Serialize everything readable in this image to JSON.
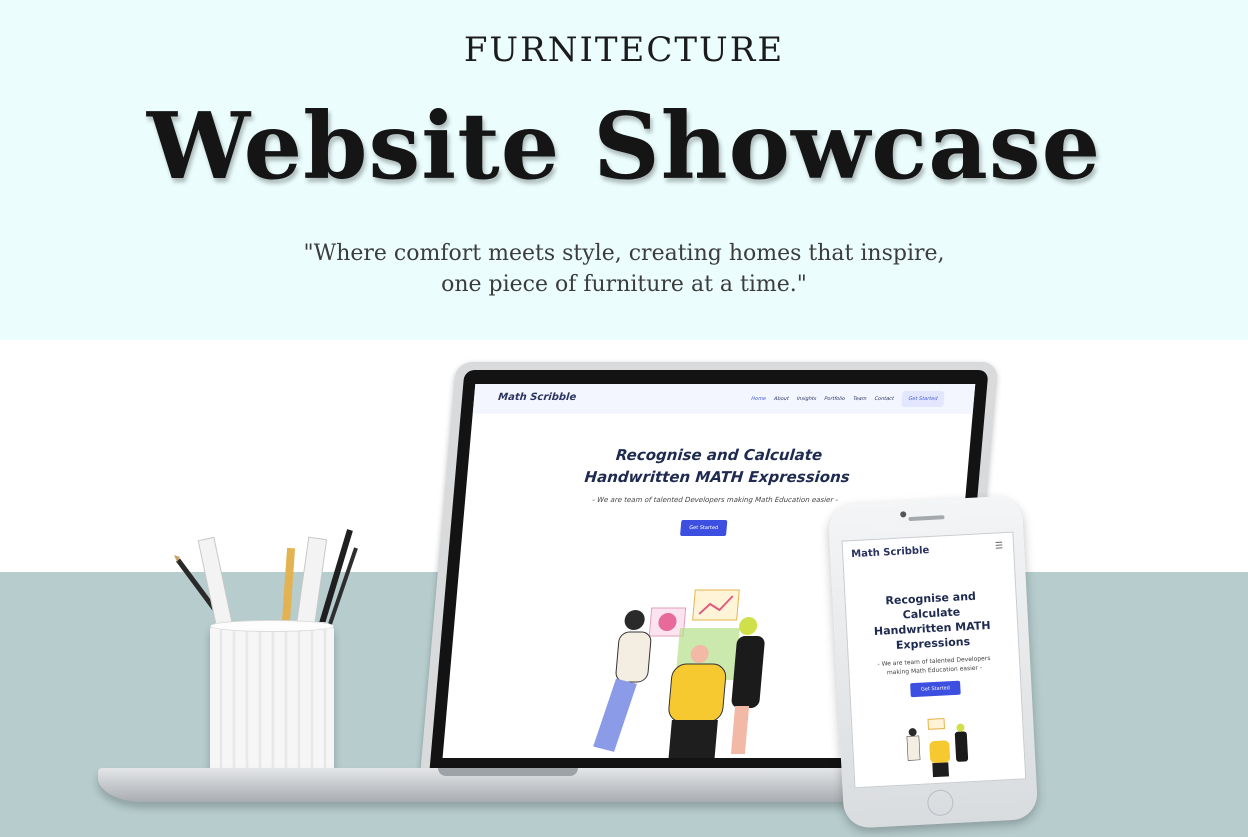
{
  "header": {
    "brand": "FURNITECTURE",
    "headline": "Website Showcase",
    "quote_lines": [
      "\"Where comfort meets style, creating homes that inspire,",
      "one piece of furniture at a time.\""
    ]
  },
  "laptop_site": {
    "logo": "Math Scribble",
    "menu": [
      "Home",
      "About",
      "Insights",
      "Portfolio",
      "Team",
      "Contact"
    ],
    "active_menu": "Home",
    "cta": "Get Started",
    "hero_title_lines": [
      "Recognise and Calculate",
      "Handwritten MATH Expressions"
    ],
    "hero_sub": "- We are team of talented Developers making Math Education easier -",
    "hero_button": "Get Started"
  },
  "phone_site": {
    "logo": "Math Scribble",
    "menu_icon": "hamburger-icon",
    "hero_title_lines": [
      "Recognise and",
      "Calculate",
      "Handwritten MATH",
      "Expressions"
    ],
    "hero_sub_lines": [
      "- We are team of talented Developers",
      "making Math Education easier -"
    ],
    "hero_button": "Get Started"
  },
  "colors": {
    "top_band": "#ebfdfd",
    "desk": "#b6cccd",
    "accent_button": "#3d4fe0",
    "site_nav_bg": "#f4f6ff"
  }
}
